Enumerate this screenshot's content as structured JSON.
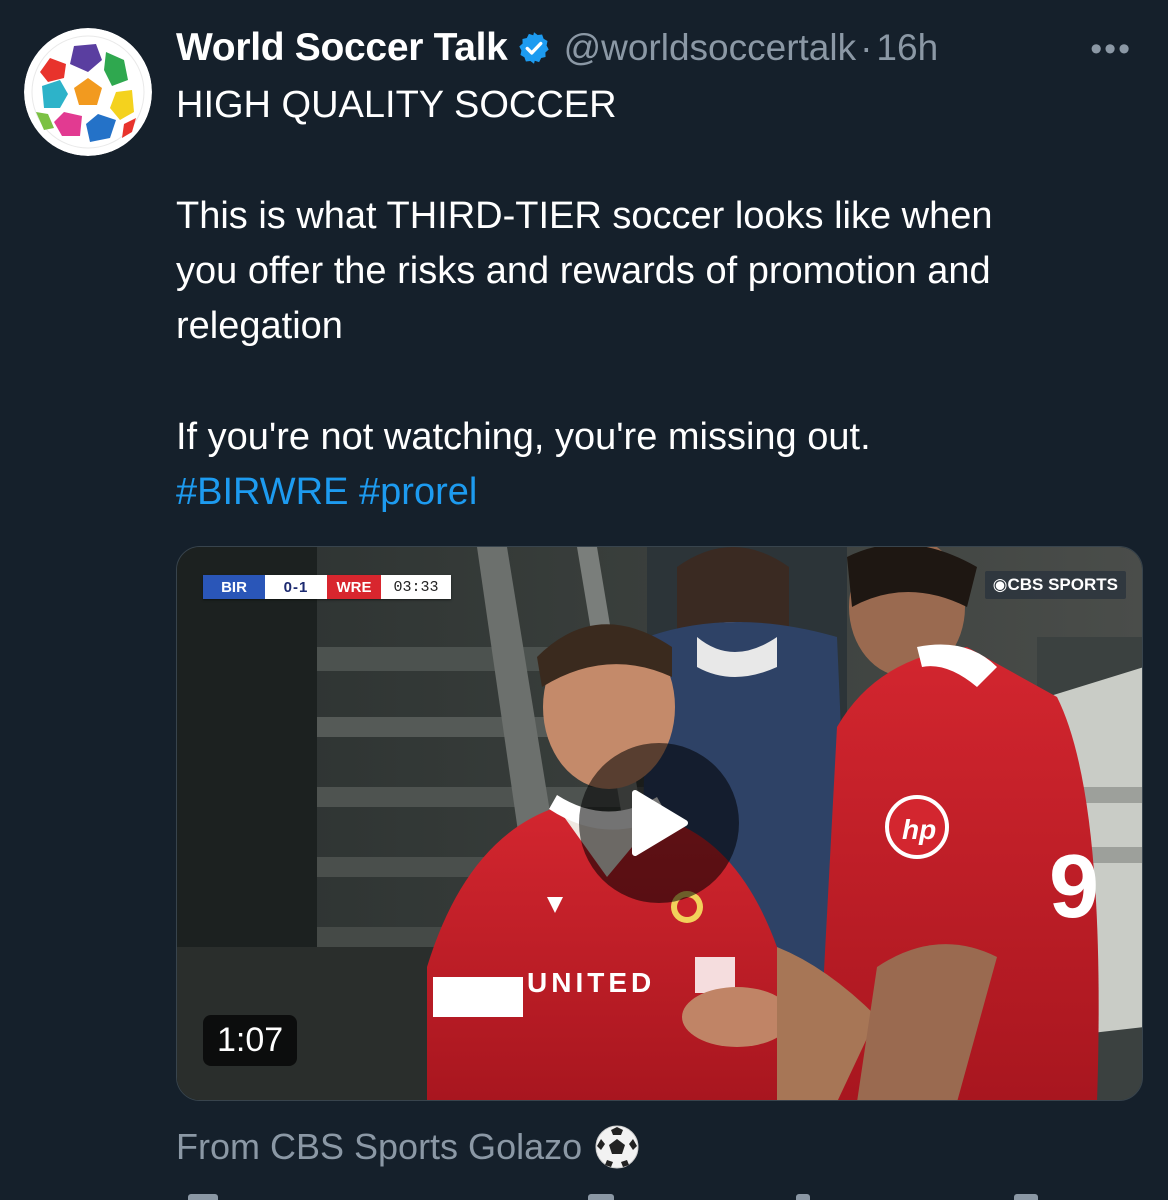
{
  "tweet": {
    "author": {
      "display_name": "World Soccer Talk",
      "handle": "@worldsoccertalk",
      "separator": "·",
      "time_ago": "16h",
      "verified": true
    },
    "text_lines": [
      "HIGH QUALITY SOCCER",
      "",
      "This is what THIRD-TIER soccer looks like when",
      "you offer the risks and rewards of promotion and",
      "relegation",
      "",
      "If you're not watching, you're missing out."
    ],
    "hashtags": [
      "#BIRWRE",
      "#prorel"
    ],
    "more_label": "•••",
    "source_label": "From CBS Sports Golazo"
  },
  "video": {
    "duration": "1:07",
    "scorebug": {
      "home": "BIR",
      "score": "0-1",
      "away": "WRE",
      "clock": "03:33"
    },
    "network": "CBS SPORTS",
    "shirt_sponsor": "UNITED",
    "shirt_number": "9"
  },
  "colors": {
    "background": "#15202b",
    "text_primary": "#ffffff",
    "text_secondary": "#8b98a5",
    "link": "#1d9bf0",
    "verified": "#1d9bf0",
    "kit_red": "#c8202a"
  },
  "icons": {
    "verified": "verified-badge-icon",
    "more": "more-options-icon",
    "play": "play-icon",
    "source": "soccer-ball-icon"
  }
}
